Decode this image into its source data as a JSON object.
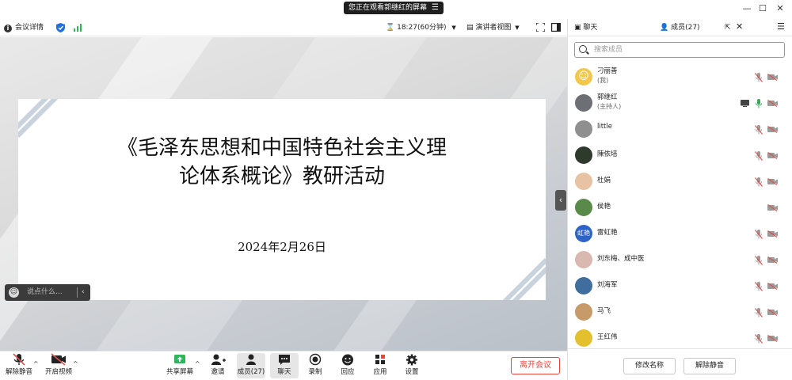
{
  "titlebar": {
    "share_notice": "您正在观看郭继红的屏幕",
    "menu_glyph": "☰",
    "minimize": "—",
    "maximize": "☐",
    "close": "✕"
  },
  "toolbar": {
    "meeting_info": "会议详情",
    "timer": "18:27(60分钟)",
    "view_mode": "演讲者视图"
  },
  "slide": {
    "title_line1": "《毛泽东思想和中国特色社会主义理",
    "title_line2": "论体系概论》教研活动",
    "date": "2024年2月26日"
  },
  "chat_input": {
    "placeholder": "说点什么..."
  },
  "bottombar": {
    "unmute": "解除静音",
    "start_video": "开启视频",
    "share_screen": "共享屏幕",
    "invite": "邀请",
    "members": "成员(27)",
    "chat": "聊天",
    "record": "录制",
    "playback": "回应",
    "apps": "应用",
    "settings": "设置",
    "leave": "离开会议"
  },
  "panel": {
    "tab_chat": "聊天",
    "tab_members": "成员(27)",
    "search_placeholder": "搜索成员",
    "members": [
      {
        "name": "刁丽善",
        "role": "(我)",
        "avatar": "#f2c84b",
        "glyph": "☺",
        "mic_muted": true,
        "cam_off": true
      },
      {
        "name": "郭继红",
        "role": "(主持人)",
        "avatar": "#6c7074",
        "glyph": "",
        "mic_muted": false,
        "cam_off": true,
        "sharing": true
      },
      {
        "name": "little",
        "role": "",
        "avatar": "#8f8f8f",
        "glyph": "",
        "mic_muted": true,
        "cam_off": true
      },
      {
        "name": "陳依培",
        "role": "",
        "avatar": "#2e3a2c",
        "glyph": "",
        "mic_muted": true,
        "cam_off": true
      },
      {
        "name": "杜娟",
        "role": "",
        "avatar": "#e7c3a4",
        "glyph": "",
        "mic_muted": true,
        "cam_off": true
      },
      {
        "name": "侯艳",
        "role": "",
        "avatar": "#5a8a4a",
        "glyph": "",
        "mic_muted": null,
        "cam_off": true
      },
      {
        "name": "雷虹艳",
        "role": "",
        "avatar": "#2e63c8",
        "glyph": "虹艳",
        "mic_muted": true,
        "cam_off": true
      },
      {
        "name": "刘东梅、成中医",
        "role": "",
        "avatar": "#d9b8b0",
        "glyph": "",
        "mic_muted": true,
        "cam_off": true
      },
      {
        "name": "刘海军",
        "role": "",
        "avatar": "#3f6e9e",
        "glyph": "",
        "mic_muted": true,
        "cam_off": true
      },
      {
        "name": "马飞",
        "role": "",
        "avatar": "#c79a6a",
        "glyph": "",
        "mic_muted": true,
        "cam_off": true
      },
      {
        "name": "王红伟",
        "role": "",
        "avatar": "#e4c02e",
        "glyph": "",
        "mic_muted": true,
        "cam_off": true
      }
    ],
    "rename": "修改名称",
    "unmute": "解除静音"
  },
  "colors": {
    "leave_red": "#e8453c",
    "mic_active_green": "#3aa757",
    "muted_red": "#d9534f",
    "shield_blue": "#1e6fe0",
    "signal_green": "#2fb65a"
  }
}
